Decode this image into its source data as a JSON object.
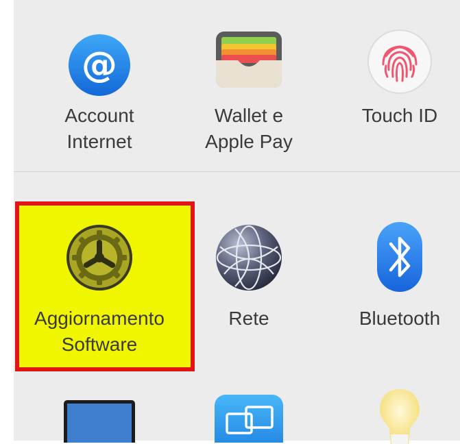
{
  "panes": {
    "internet_accounts": {
      "label": "Account\nInternet",
      "icon": "at-sign-icon",
      "color": "#1f87e8"
    },
    "wallet": {
      "label": "Wallet e\nApple Pay",
      "icon": "wallet-icon"
    },
    "touch_id": {
      "label": "Touch ID",
      "icon": "fingerprint-icon",
      "color": "#f0566f"
    },
    "software_update": {
      "label": "Aggiornamento\nSoftware",
      "icon": "gear-icon",
      "highlighted": true,
      "highlight_color": "#f0f500",
      "border_color": "#e01515"
    },
    "network": {
      "label": "Rete",
      "icon": "globe-icon"
    },
    "bluetooth": {
      "label": "Bluetooth",
      "icon": "bluetooth-icon",
      "color": "#1f7bea"
    },
    "displays": {
      "icon": "monitor-icon"
    },
    "sidecar": {
      "icon": "sidecar-icon"
    },
    "energy_saver": {
      "icon": "lightbulb-icon"
    }
  }
}
